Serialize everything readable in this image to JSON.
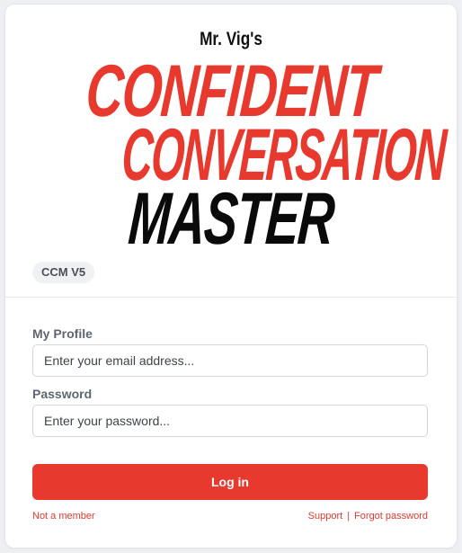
{
  "logo": {
    "small": "Mr. Vig's",
    "line1": "CONFIDENT",
    "line2": "CONVERSATION",
    "line3": "MASTER"
  },
  "badge": "CCM V5",
  "form": {
    "email_label": "My Profile",
    "email_placeholder": "Enter your email address...",
    "email_value": "",
    "password_label": "Password",
    "password_placeholder": "Enter your password...",
    "password_value": "",
    "login_label": "Log in"
  },
  "links": {
    "not_member": "Not a member",
    "support": "Support",
    "separator": "|",
    "forgot_password": "Forgot password"
  },
  "colors": {
    "accent": "#e8392f",
    "logo_black": "#0a0a0a"
  }
}
